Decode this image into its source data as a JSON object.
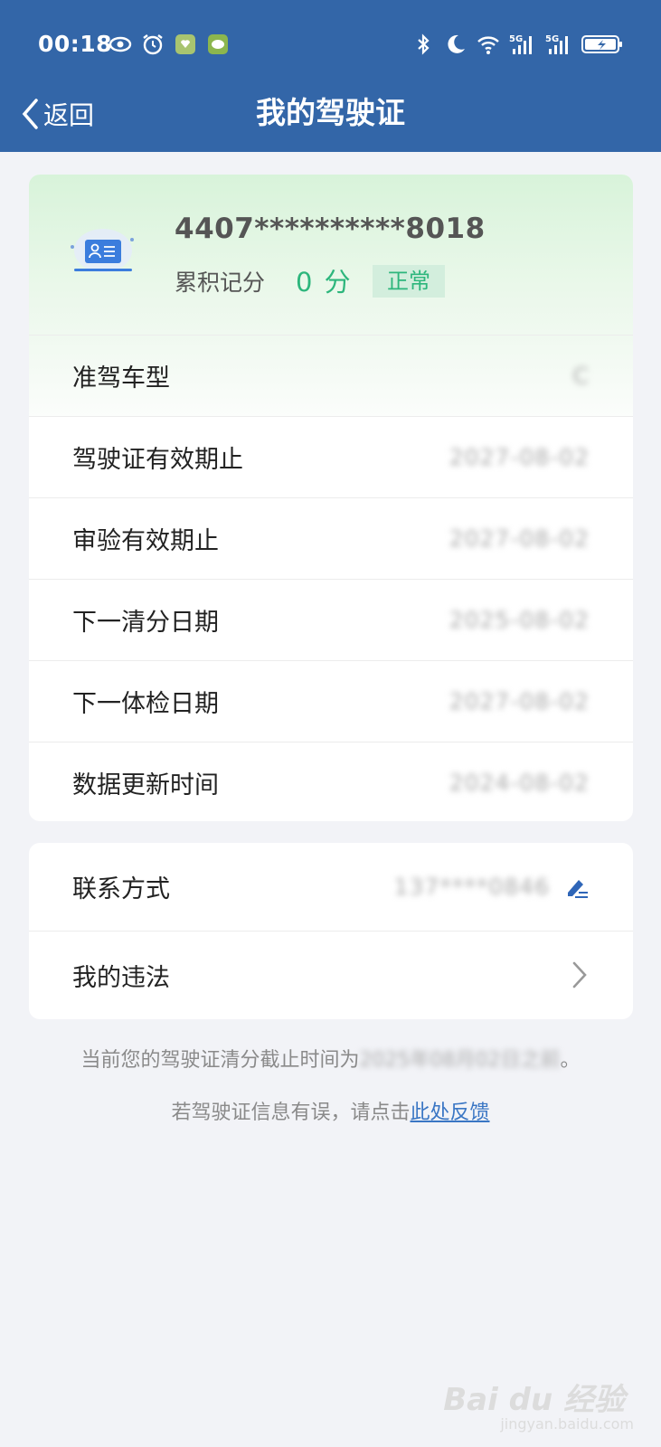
{
  "status_bar": {
    "time": "00:18",
    "left_icons": [
      "eye-icon",
      "alarm-icon",
      "app-badge-icon",
      "message-badge-icon"
    ],
    "right_icons": [
      "bluetooth-icon",
      "moon-icon",
      "wifi-icon",
      "signal-5g-icon",
      "signal-5g-icon",
      "battery-icon"
    ]
  },
  "nav": {
    "back_label": "返回",
    "title": "我的驾驶证"
  },
  "license": {
    "number": "4407**********8018",
    "points_label": "累积记分",
    "points_value": "0 分",
    "status": "正常"
  },
  "info_rows": [
    {
      "label": "准驾车型",
      "value": "C"
    },
    {
      "label": "驾驶证有效期止",
      "value": "2027-08-02"
    },
    {
      "label": "审验有效期止",
      "value": "2027-08-02"
    },
    {
      "label": "下一清分日期",
      "value": "2025-08-02"
    },
    {
      "label": "下一体检日期",
      "value": "2027-08-02"
    },
    {
      "label": "数据更新时间",
      "value": "2024-08-02"
    }
  ],
  "contact": {
    "label": "联系方式",
    "value": "137****0846"
  },
  "violations": {
    "label": "我的违法"
  },
  "notice": {
    "prefix": "当前您的驾驶证清分截止时间为",
    "blurred": "2025年08月02日之前",
    "suffix": "。",
    "feedback_prefix": "若驾驶证信息有误，请点击",
    "feedback_link": "此处反馈"
  },
  "watermark": {
    "brand": "Bai du 经验",
    "url": "jingyan.baidu.com"
  },
  "colors": {
    "header": "#3366a8",
    "accent_green": "#2db67c",
    "link_blue": "#3a76c4"
  }
}
